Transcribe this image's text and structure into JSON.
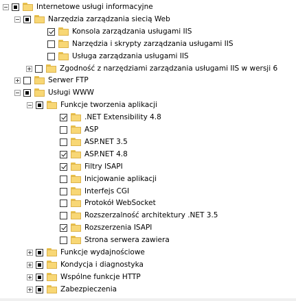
{
  "tree": {
    "items": [
      {
        "label": "Internetowe usługi informacyjne",
        "expander": "minus",
        "check": "partial"
      },
      {
        "label": "Narzędzia zarządzania siecią Web",
        "expander": "minus",
        "check": "partial"
      },
      {
        "label": "Konsola zarządzania usługami IIS",
        "expander": "none",
        "check": "checked"
      },
      {
        "label": "Narzędzia i skrypty zarządzania usługami IIS",
        "expander": "none",
        "check": "unchecked"
      },
      {
        "label": "Usługa zarządzania usługami IIS",
        "expander": "none",
        "check": "unchecked"
      },
      {
        "label": "Zgodność z narzędziami zarządzania usługami IIS w wersji 6",
        "expander": "plus",
        "check": "unchecked"
      },
      {
        "label": "Serwer FTP",
        "expander": "plus",
        "check": "unchecked"
      },
      {
        "label": "Usługi WWW",
        "expander": "minus",
        "check": "partial"
      },
      {
        "label": "Funkcje tworzenia aplikacji",
        "expander": "minus",
        "check": "partial"
      },
      {
        "label": ".NET Extensibility 4.8",
        "expander": "none",
        "check": "checked"
      },
      {
        "label": "ASP",
        "expander": "none",
        "check": "unchecked"
      },
      {
        "label": "ASP.NET 3.5",
        "expander": "none",
        "check": "unchecked"
      },
      {
        "label": "ASP.NET 4.8",
        "expander": "none",
        "check": "checked"
      },
      {
        "label": "Filtry ISAPI",
        "expander": "none",
        "check": "checked"
      },
      {
        "label": "Inicjowanie aplikacji",
        "expander": "none",
        "check": "unchecked"
      },
      {
        "label": "Interfejs CGI",
        "expander": "none",
        "check": "unchecked"
      },
      {
        "label": "Protokół WebSocket",
        "expander": "none",
        "check": "unchecked"
      },
      {
        "label": "Rozszerzalność architektury .NET 3.5",
        "expander": "none",
        "check": "unchecked"
      },
      {
        "label": "Rozszerzenia ISAPI",
        "expander": "none",
        "check": "checked"
      },
      {
        "label": "Strona serwera zawiera",
        "expander": "none",
        "check": "unchecked"
      },
      {
        "label": "Funkcje wydajnościowe",
        "expander": "plus",
        "check": "partial"
      },
      {
        "label": "Kondycja i diagnostyka",
        "expander": "plus",
        "check": "partial"
      },
      {
        "label": "Wspólne funkcje HTTP",
        "expander": "plus",
        "check": "partial"
      },
      {
        "label": "Zabezpieczenia",
        "expander": "plus",
        "check": "partial"
      }
    ]
  },
  "colors": {
    "folder": "#f8d775",
    "background": "#ffffff"
  }
}
